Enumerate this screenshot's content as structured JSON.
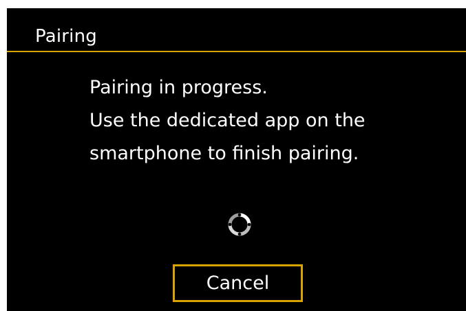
{
  "header": {
    "title": "Pairing"
  },
  "message": {
    "lines": [
      "Pairing in progress.",
      "Use the dedicated app on the",
      "smartphone to finish pairing."
    ]
  },
  "spinner": {
    "icon": "loading-spinner-icon"
  },
  "actions": {
    "cancel_label": "Cancel"
  },
  "colors": {
    "accent": "#d9a400",
    "background": "#000000",
    "text": "#ffffff"
  }
}
